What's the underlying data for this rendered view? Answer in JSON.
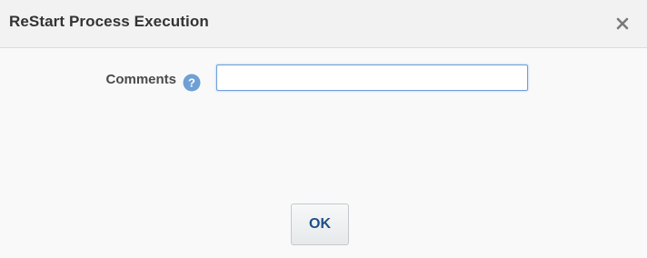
{
  "dialog": {
    "title": "ReStart Process Execution",
    "close_icon": "close-icon"
  },
  "form": {
    "comments_label": "Comments",
    "help_icon": "help-icon",
    "comments_value": "",
    "comments_placeholder": ""
  },
  "footer": {
    "ok_label": "OK"
  },
  "colors": {
    "title_text": "#333333",
    "label_text": "#4a4a4a",
    "help_icon": "#6ea0d6",
    "input_focus_border": "#6fa1d9",
    "ok_text": "#1d4f8a",
    "close_icon": "#7a7a7a"
  }
}
